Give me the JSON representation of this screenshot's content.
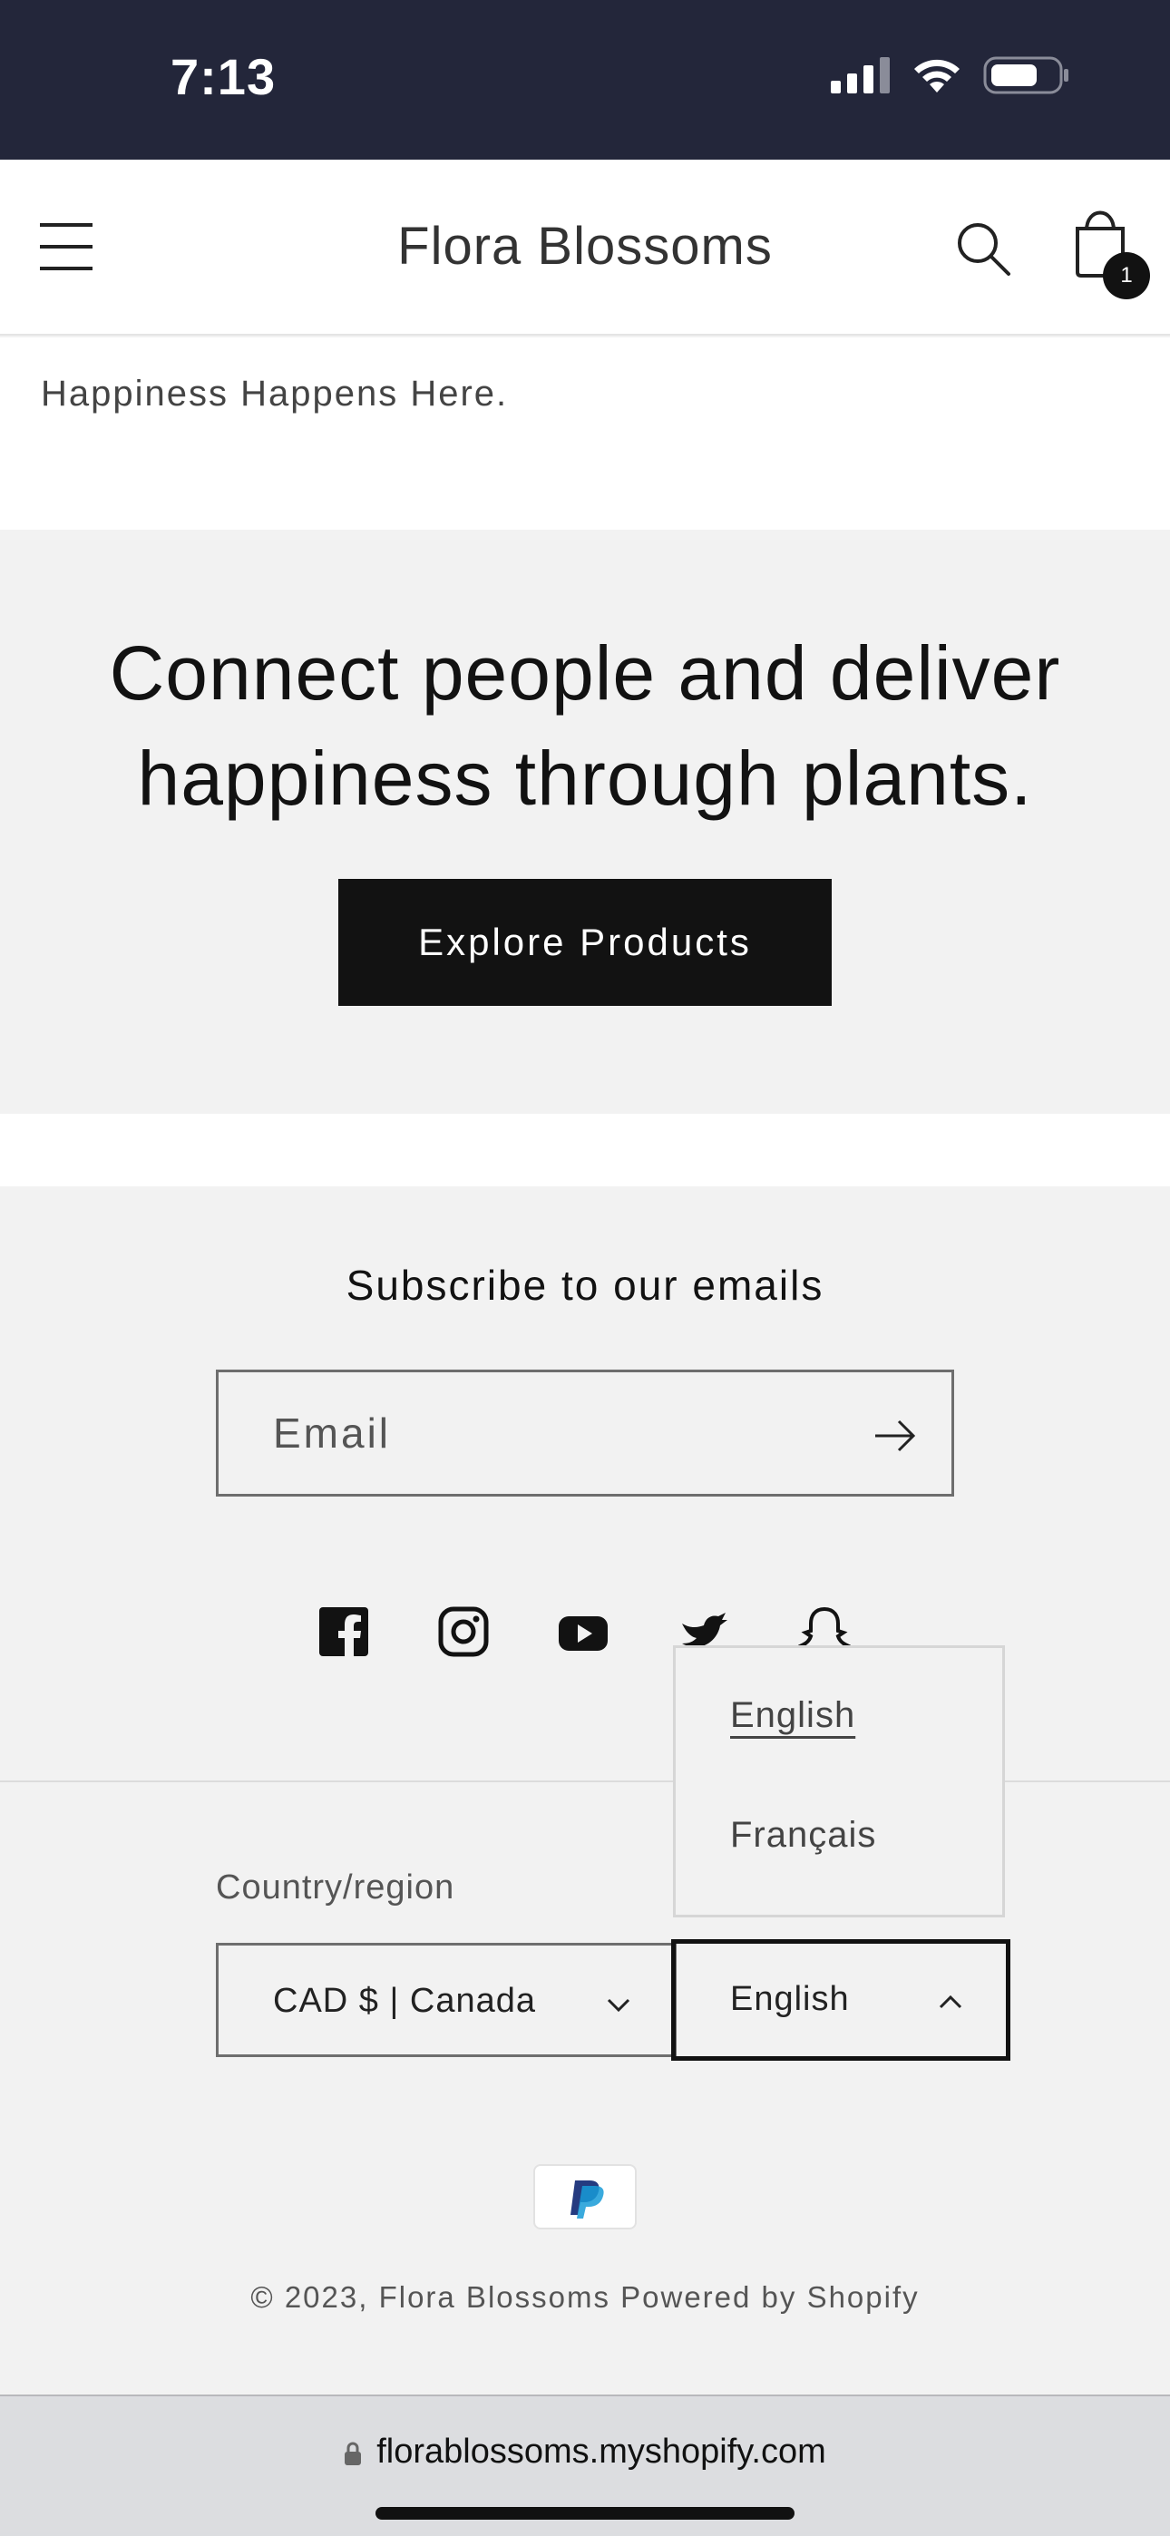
{
  "status_bar": {
    "time": "7:13"
  },
  "header": {
    "brand": "Flora Blossoms",
    "cart_count": "1"
  },
  "tagline": "Happiness Happens Here.",
  "hero": {
    "title": "Connect people and deliver happiness through plants.",
    "button_label": "Explore Products"
  },
  "newsletter": {
    "title": "Subscribe to our emails",
    "email_placeholder": "Email"
  },
  "socials": [
    "facebook-icon",
    "instagram-icon",
    "youtube-icon",
    "twitter-icon",
    "snapchat-icon"
  ],
  "localization": {
    "country_label": "Country/region",
    "country_value": "CAD $ | Canada",
    "language_value": "English",
    "language_options": [
      "English",
      "Français"
    ],
    "language_selected": "English"
  },
  "footer": {
    "payment": "PayPal",
    "copyright": "© 2023, Flora Blossoms Powered by Shopify"
  },
  "browser": {
    "url": "florablossoms.myshopify.com"
  }
}
